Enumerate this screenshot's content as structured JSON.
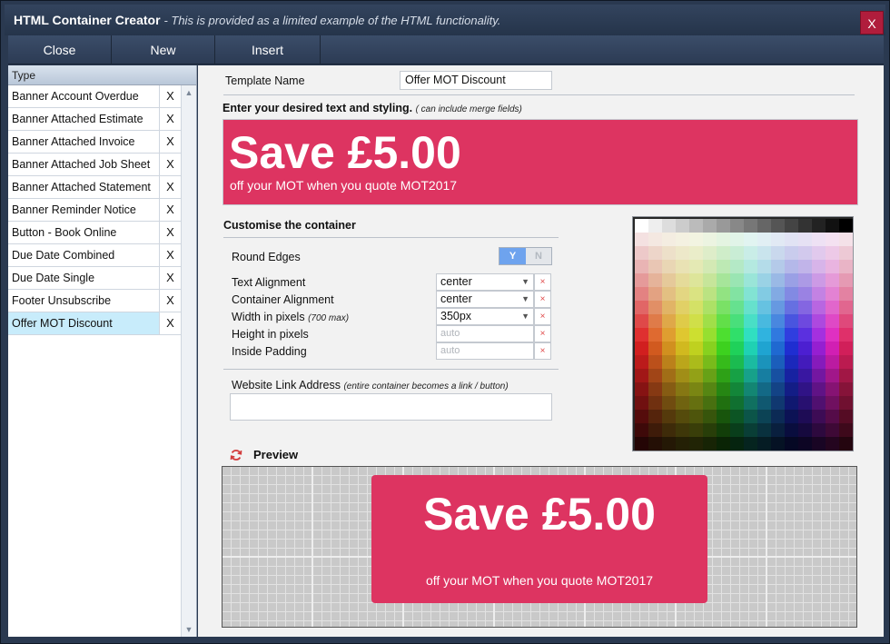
{
  "window": {
    "title": "HTML Container Creator",
    "subtitle": "- This is provided as a limited example of the HTML functionality.",
    "close_label": "X"
  },
  "toolbar": {
    "close_label": "Close",
    "new_label": "New",
    "insert_label": "Insert"
  },
  "sidebar": {
    "header": "Type",
    "remove_label": "X",
    "items": [
      {
        "label": "Banner Account Overdue"
      },
      {
        "label": "Banner Attached Estimate"
      },
      {
        "label": "Banner Attached Invoice"
      },
      {
        "label": "Banner Attached Job Sheet"
      },
      {
        "label": "Banner Attached Statement"
      },
      {
        "label": "Banner Reminder Notice"
      },
      {
        "label": "Button - Book Online"
      },
      {
        "label": "Due Date Combined"
      },
      {
        "label": "Due Date Single"
      },
      {
        "label": "Footer Unsubscribe"
      },
      {
        "label": "Offer MOT Discount"
      }
    ],
    "selected_index": 10
  },
  "form": {
    "template_name_label": "Template Name",
    "template_name_value": "Offer MOT Discount",
    "text_heading": "Enter your desired text and styling.",
    "text_hint": "( can include merge fields)",
    "content_big": "Save £5.00",
    "content_small": "off your MOT when you quote MOT2017",
    "customise_heading": "Customise the container",
    "round_edges_label": "Round Edges",
    "round_edges_yes": "Y",
    "round_edges_no": "N",
    "round_edges_value": "Y",
    "text_alignment_label": "Text Alignment",
    "text_alignment_value": "center",
    "container_alignment_label": "Container Alignment",
    "container_alignment_value": "center",
    "width_label": "Width  in pixels",
    "width_hint": "(700 max)",
    "width_value": "350px",
    "height_label": "Height in pixels",
    "height_value": "auto",
    "padding_label": "Inside Padding",
    "padding_value": "auto",
    "clear_label": "×",
    "link_label": "Website Link Address",
    "link_hint": "(entire container becomes a link / button)",
    "link_value": ""
  },
  "preview": {
    "heading": "Preview",
    "big": "Save £5.00",
    "small": "off your MOT when you quote MOT2017"
  },
  "colors": {
    "accent": "#dd3461",
    "toggle_on": "#6ea3ee",
    "selected_row": "#c8ecfb"
  },
  "icons": {
    "refresh": "refresh-icon",
    "dropdown": "chevron-down-icon",
    "clear": "clear-icon"
  }
}
